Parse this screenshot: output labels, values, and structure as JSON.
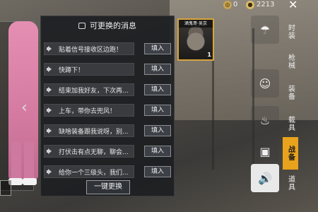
{
  "topbar": {
    "coin1_icon": "coin-icon",
    "coin1_value": "0",
    "coin2_icon": "coin-icon",
    "coin2_value": "2213",
    "close_icon": "close-icon"
  },
  "panel": {
    "title": "可更换的消息",
    "messages": [
      {
        "text": "贴着信号接收区边跑！",
        "button": "填入"
      },
      {
        "text": "快蹲下！",
        "button": "填入"
      },
      {
        "text": "结束加我好友，下次再...",
        "button": "填入"
      },
      {
        "text": "上车，带你去兜风！",
        "button": "填入"
      },
      {
        "text": "缺啥装备跟我说呀，别...",
        "button": "填入"
      },
      {
        "text": "打伏击有点无聊，聊会...",
        "button": "填入"
      },
      {
        "text": "给你一个三级头，我们...",
        "button": "填入"
      }
    ],
    "swap_button": "一键更换"
  },
  "avatar": {
    "name": "酒鬼哥·吴京",
    "count": "1"
  },
  "tabs": [
    "时装",
    "枪械",
    "装备",
    "载具",
    "战备",
    "道具"
  ],
  "active_tab": "战备",
  "strip_icons": [
    "parachute-icon",
    "smile-icon",
    "spray-icon",
    "photo-icon",
    "speaker-icon"
  ],
  "colors": {
    "accent": "#e8a21c",
    "panel_bg": "#1c1e22",
    "avatar_border": "#d7a43c"
  }
}
